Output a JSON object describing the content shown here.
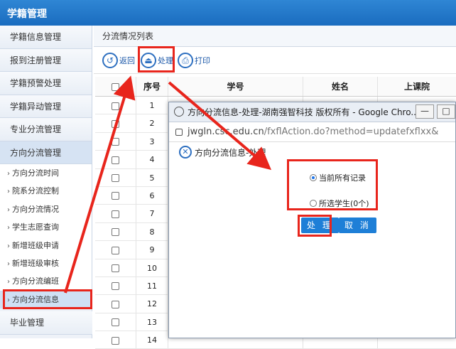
{
  "app": {
    "title": "学籍管理"
  },
  "sidebar": {
    "items": [
      {
        "label": "学籍信息管理"
      },
      {
        "label": "报到注册管理"
      },
      {
        "label": "学籍预警处理"
      },
      {
        "label": "学籍异动管理"
      },
      {
        "label": "专业分流管理"
      },
      {
        "label": "方向分流管理"
      }
    ],
    "sub_items": [
      {
        "label": "方向分流时间"
      },
      {
        "label": "院系分流控制"
      },
      {
        "label": "方向分流情况"
      },
      {
        "label": "学生志愿查询"
      },
      {
        "label": "新增班级申请"
      },
      {
        "label": "新增班级审核"
      },
      {
        "label": "方向分流编班"
      },
      {
        "label": "方向分流信息"
      }
    ],
    "bottom_item": {
      "label": "毕业管理"
    }
  },
  "main": {
    "title": "分流情况列表",
    "toolbar": {
      "back_label": "返回",
      "process_label": "处理",
      "print_label": "打印"
    },
    "table": {
      "columns": [
        "序号",
        "学号",
        "姓名",
        "上课院"
      ],
      "row_numbers": [
        "1",
        "2",
        "3",
        "4",
        "5",
        "6",
        "7",
        "8",
        "9",
        "10",
        "11",
        "12",
        "13",
        "14"
      ]
    }
  },
  "popup": {
    "window_title": "方向分流信息-处理-湖南强智科技 版权所有 - Google Chro...",
    "url_host": "jwgln.csc.edu.cn",
    "url_path": "/fxflAction.do?method=updatefxflxx&",
    "header": "方向分流信息-处理",
    "option_all": "当前所有记录",
    "option_selected": "所选学生(0个)",
    "process_button": "处 理",
    "cancel_button": "取 消",
    "min_symbol": "—",
    "max_symbol": "□"
  },
  "colors": {
    "topbar": "#1a6cbf",
    "accent": "#1e7fd7",
    "annotation_red": "#e8251c"
  }
}
